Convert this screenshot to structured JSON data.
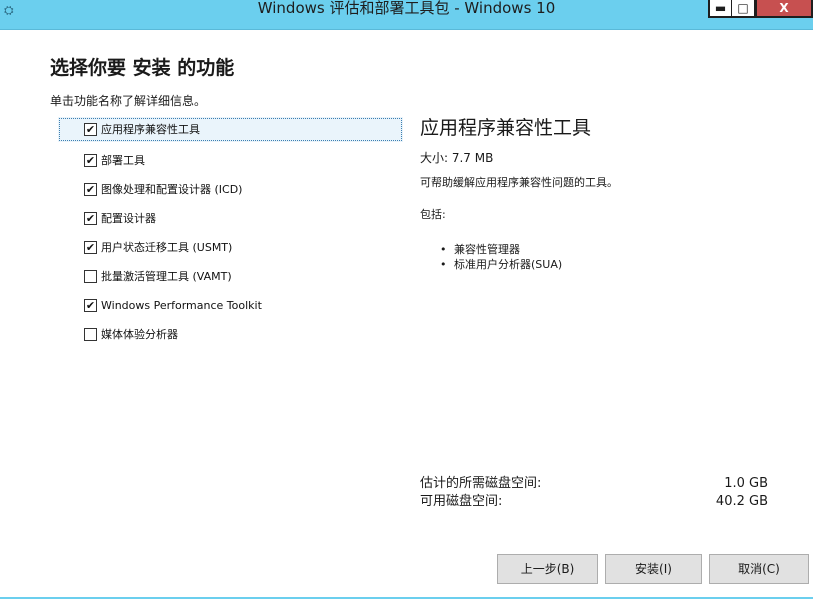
{
  "window": {
    "title": "Windows 评估和部署工具包 - Windows 10",
    "minimize_glyph": "▬",
    "maximize_glyph": "□",
    "close_glyph": "X"
  },
  "page": {
    "heading": "选择你要 安装 的功能",
    "hint": "单击功能名称了解详细信息。"
  },
  "features": [
    {
      "label": "应用程序兼容性工具",
      "checked": true,
      "selected": true
    },
    {
      "label": "部署工具",
      "checked": true,
      "selected": false
    },
    {
      "label": "图像处理和配置设计器 (ICD)",
      "checked": true,
      "selected": false
    },
    {
      "label": "配置设计器",
      "checked": true,
      "selected": false
    },
    {
      "label": "用户状态迁移工具 (USMT)",
      "checked": true,
      "selected": false
    },
    {
      "label": "批量激活管理工具 (VAMT)",
      "checked": false,
      "selected": false
    },
    {
      "label": "Windows Performance Toolkit",
      "checked": true,
      "selected": false
    },
    {
      "label": "媒体体验分析器",
      "checked": false,
      "selected": false
    }
  ],
  "detail": {
    "title": "应用程序兼容性工具",
    "size": "大小: 7.7 MB",
    "description": "可帮助缓解应用程序兼容性问题的工具。",
    "includes_label": "包括:",
    "includes": [
      "兼容性管理器",
      "标准用户分析器(SUA)"
    ]
  },
  "disk": {
    "required_label": "估计的所需磁盘空间:",
    "required_value": "1.0 GB",
    "available_label": "可用磁盘空间:",
    "available_value": "40.2 GB"
  },
  "buttons": {
    "back": "上一步(B)",
    "install": "安装(I)",
    "cancel": "取消(C)"
  },
  "colors": {
    "titlebar": "#6bcfee",
    "close_button": "#c75050"
  }
}
